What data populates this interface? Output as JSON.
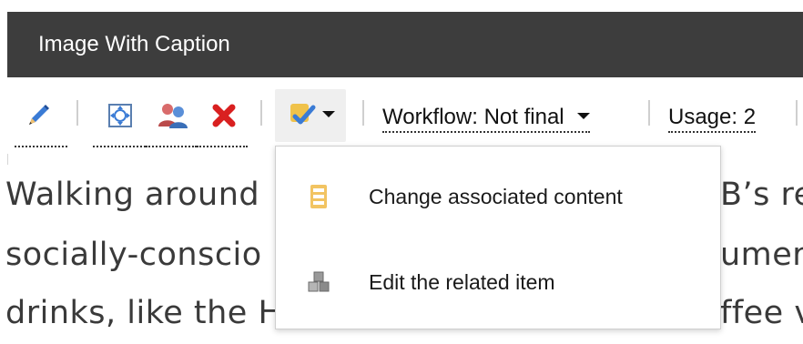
{
  "window": {
    "title": "Image With Caption"
  },
  "toolbar": {
    "edit_icon": "pencil-icon",
    "properties_icon": "properties-icon",
    "users_icon": "users-icon",
    "delete_icon": "delete-icon",
    "workflow_menu_icon": "check-tasks-icon",
    "workflow_label": "Workflow: Not final",
    "usage_label": "Usage: 2"
  },
  "dropdown": {
    "items": [
      {
        "label": "Change associated content",
        "icon": "content-list-icon"
      },
      {
        "label": "Edit the related item",
        "icon": "related-item-icon"
      }
    ]
  },
  "article": {
    "lines": [
      "Walking around",
      "socially-conscio",
      "drinks, like the H"
    ],
    "right_fragments": [
      "B’s re",
      "umer.",
      "ffee v"
    ]
  },
  "colors": {
    "titlebar": "#3d3d3d",
    "accent_blue": "#3a7bd5",
    "delete_red": "#d92020"
  }
}
